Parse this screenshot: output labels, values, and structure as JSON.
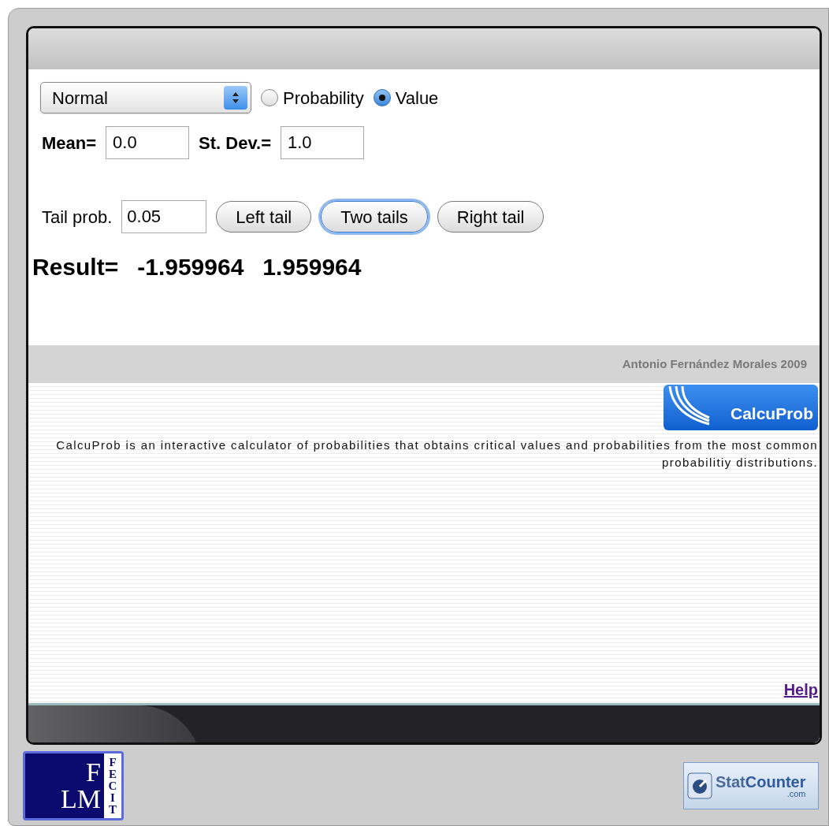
{
  "distribution": {
    "value": "Normal"
  },
  "modes": [
    {
      "label": "Probability",
      "selected": false
    },
    {
      "label": "Value",
      "selected": true
    }
  ],
  "parameters": [
    {
      "label": "Mean=",
      "value": "0.0"
    },
    {
      "label": "St. Dev.=",
      "value": "1.0"
    }
  ],
  "tail_prob": {
    "label": "Tail prob.",
    "value": "0.05"
  },
  "tail_buttons": [
    {
      "label": "Left tail",
      "selected": false
    },
    {
      "label": "Two tails",
      "selected": true
    },
    {
      "label": "Right tail",
      "selected": false
    }
  ],
  "result": {
    "label": "Result=",
    "values": [
      "-1.959964",
      "1.959964"
    ]
  },
  "author": "Antonio Fernández Morales 2009",
  "app_logo": {
    "text": "CalcuProb"
  },
  "description": "CalcuProb is an interactive calculator of probabilities that obtains critical values and probabilities from the most common probabilitiy distributions.",
  "help_link": "Help",
  "fecit_logo": {
    "monogram_top": "F",
    "monogram_bottom": "LM",
    "side_text": "FECIT"
  },
  "statcounter_badge": {
    "name_part_1": "Stat",
    "name_part_2": "Counter",
    "domain": ".com"
  }
}
